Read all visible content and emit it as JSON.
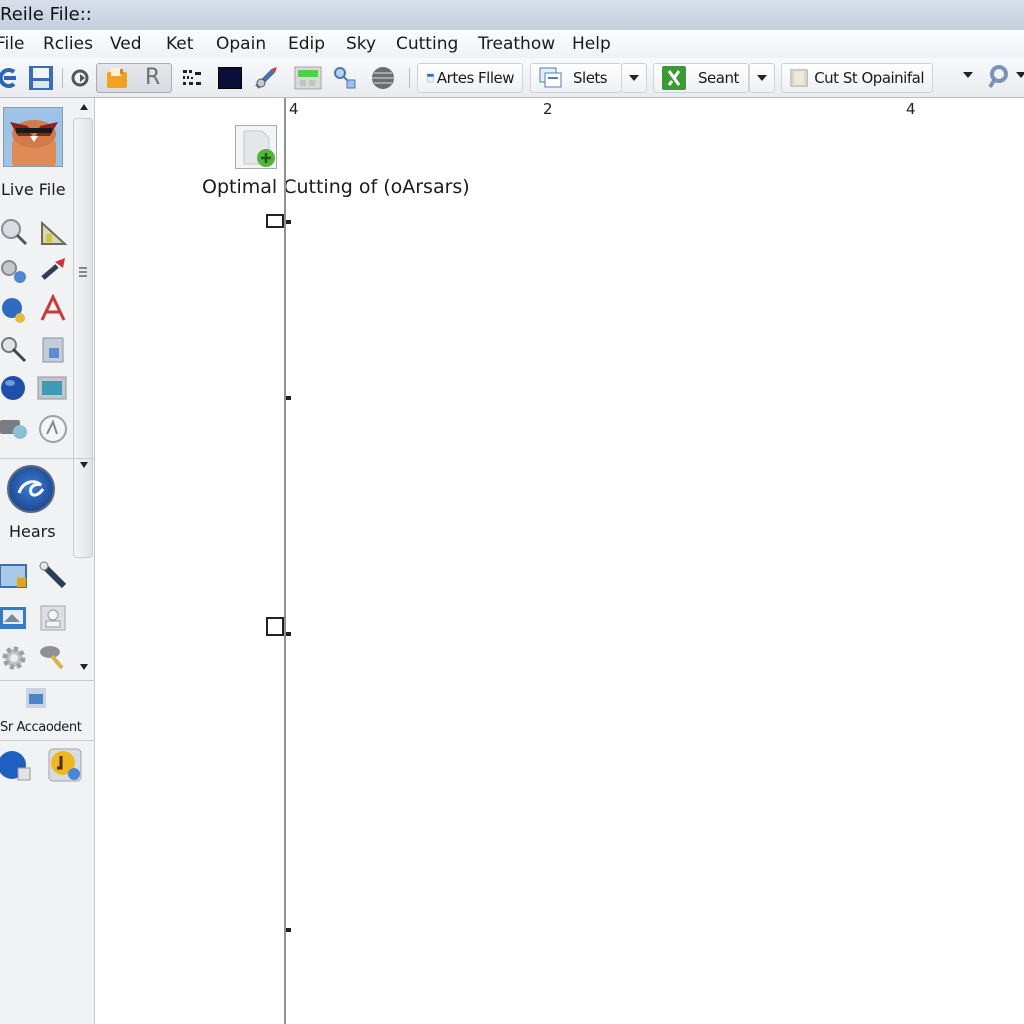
{
  "window": {
    "title": "Reile File::"
  },
  "menu": [
    "File",
    "Rclies",
    "Ved",
    "Ket",
    "Opain",
    "Edip",
    "Sky",
    "Cutting",
    "Treathow",
    "Help"
  ],
  "toolbar": {
    "icons": [
      "refresh-icon",
      "save-disk-icon",
      "back-icon",
      "folder-icon",
      "r-icon",
      "grid-icon",
      "dark-square-icon",
      "tool-icon",
      "green-panel-icon",
      "connect-icon",
      "globe-icon"
    ],
    "artes_flew_label": "Artes Fllew",
    "slets_label": "Slets",
    "seant_label": "Seant",
    "cut_label": "Cut St Opainifal"
  },
  "sidebar": {
    "top_label": "Live File",
    "middle_label": "Hears",
    "bottom_label": "Sr Accaodent"
  },
  "canvas": {
    "ruler_labels": [
      "4",
      "2",
      "4"
    ],
    "document_title": "Optimal Cutting of (oArsars)"
  }
}
